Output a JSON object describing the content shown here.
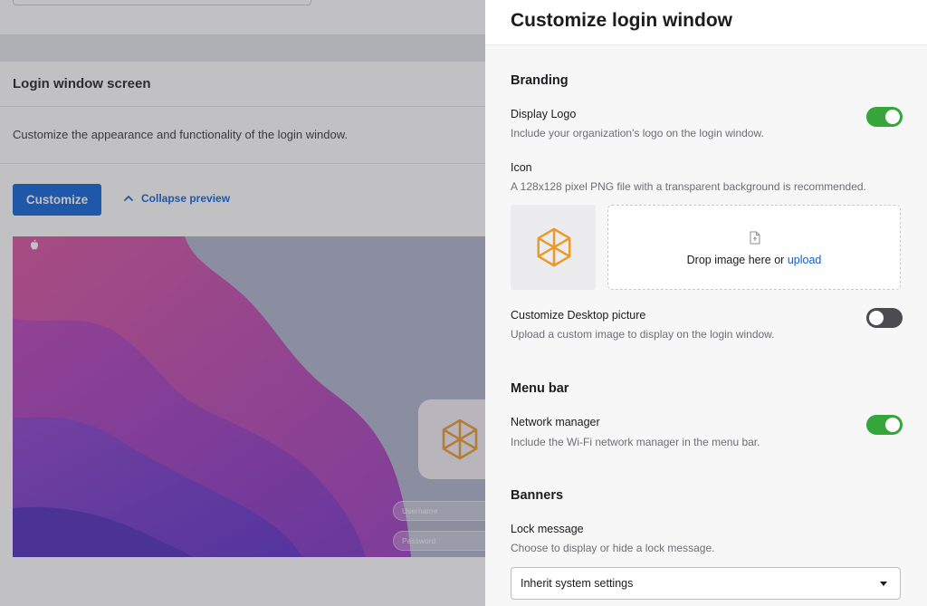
{
  "background": {
    "section_title": "Login window screen",
    "description": "Customize the appearance and functionality of the login window.",
    "customize_button": "Customize",
    "collapse_link": "Collapse preview",
    "preview": {
      "username_placeholder": "Username",
      "password_placeholder": "Password"
    }
  },
  "panel": {
    "title": "Customize login window",
    "branding": {
      "heading": "Branding",
      "display_logo": {
        "label": "Display Logo",
        "help": "Include your organization's logo on the login window.",
        "enabled": true
      },
      "icon": {
        "label": "Icon",
        "help": "A 128x128 pixel PNG file with a transparent background is recommended.",
        "drop_text": "Drop image here or",
        "upload_link": "upload"
      },
      "desktop_picture": {
        "label": "Customize Desktop picture",
        "help": "Upload a custom image to display on the login window.",
        "enabled": false
      }
    },
    "menu_bar": {
      "heading": "Menu bar",
      "network_manager": {
        "label": "Network manager",
        "help": "Include the Wi-Fi network manager in the menu bar.",
        "enabled": true
      }
    },
    "banners": {
      "heading": "Banners",
      "lock_message": {
        "label": "Lock message",
        "help": "Choose to display or hide a lock message.",
        "selected": "Inherit system settings"
      }
    }
  },
  "icons": {
    "logo": "hexagon-cube-logo-icon",
    "apple": "apple-logo-icon",
    "file": "file-upload-icon",
    "chevron": "chevron-up-icon",
    "caret": "dropdown-caret-icon"
  },
  "colors": {
    "accent": "#0a5ed6",
    "toggle_on": "#34a63a",
    "toggle_off": "#4b4b50",
    "logo_orange": "#e89a2c"
  }
}
